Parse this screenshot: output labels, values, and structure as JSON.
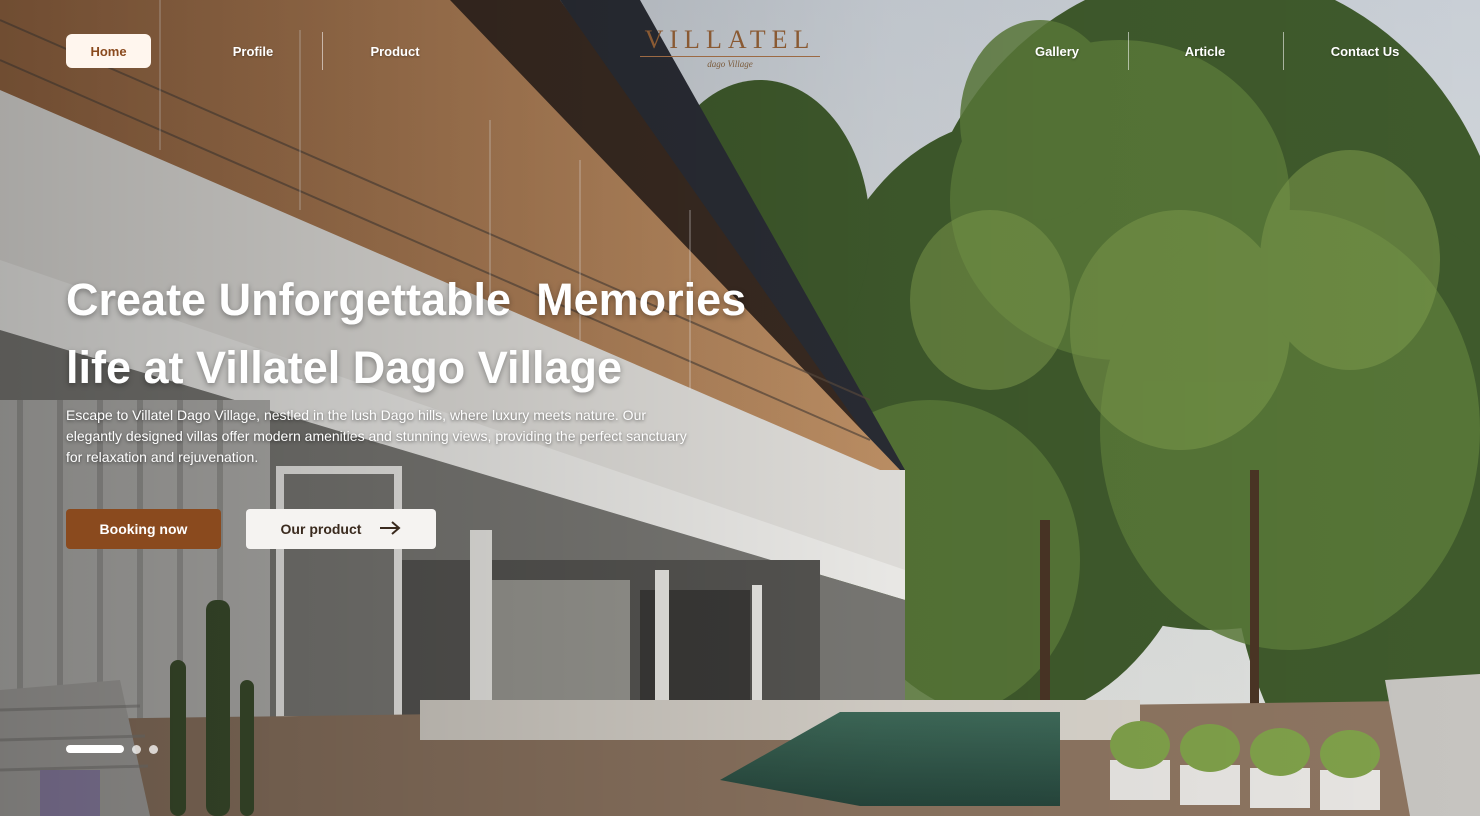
{
  "nav": {
    "left": [
      {
        "label": "Home",
        "active": true
      },
      {
        "label": "Profile",
        "active": false
      },
      {
        "label": "Product",
        "active": false
      }
    ],
    "right": [
      {
        "label": "Gallery"
      },
      {
        "label": "Article"
      },
      {
        "label": "Contact Us"
      }
    ]
  },
  "logo": {
    "brand": "VILLATEL",
    "sub": "dago Village"
  },
  "hero": {
    "headline_line1": "Create Unforgettable  Memories",
    "headline_line2": "life at Villatel Dago Village",
    "description": "Escape to Villatel Dago Village, nestled in the lush Dago hills, where luxury meets nature. Our elegantly designed villas offer modern amenities and stunning views, providing the perfect sanctuary for relaxation and rejuvenation.",
    "cta_primary": "Booking now",
    "cta_secondary": "Our product",
    "cta_secondary_icon": "arrow-right-icon"
  },
  "carousel": {
    "total": 3,
    "current": 1
  },
  "colors": {
    "brand": "#8a4a1e",
    "pill_bg": "#fff6ee",
    "text_light": "#ffffff"
  }
}
